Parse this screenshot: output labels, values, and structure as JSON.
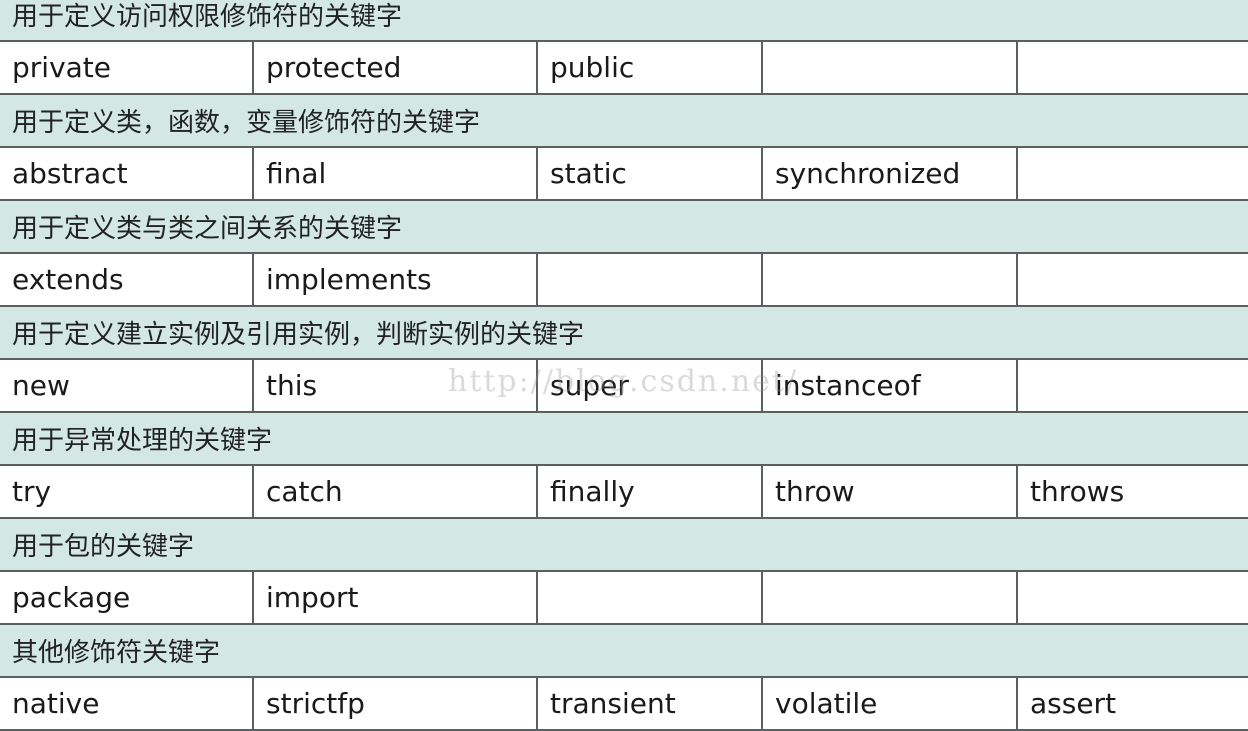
{
  "sections": [
    {
      "title": "用于定义访问权限修饰符的关键字",
      "keywords": [
        "private",
        "protected",
        "public",
        "",
        ""
      ]
    },
    {
      "title": "用于定义类，函数，变量修饰符的关键字",
      "keywords": [
        "abstract",
        "final",
        "static",
        "synchronized",
        ""
      ]
    },
    {
      "title": "用于定义类与类之间关系的关键字",
      "keywords": [
        "extends",
        "implements",
        "",
        "",
        ""
      ]
    },
    {
      "title": "用于定义建立实例及引用实例，判断实例的关键字",
      "keywords": [
        "new",
        "this",
        "super",
        "instanceof",
        ""
      ]
    },
    {
      "title": "用于异常处理的关键字",
      "keywords": [
        "try",
        "catch",
        "finally",
        "throw",
        "throws"
      ]
    },
    {
      "title": "用于包的关键字",
      "keywords": [
        "package",
        "import",
        "",
        "",
        ""
      ]
    },
    {
      "title": "其他修饰符关键字",
      "keywords": [
        "native",
        "strictfp",
        "transient",
        "volatile",
        "assert"
      ]
    }
  ],
  "watermark": "http://blog.csdn.net/",
  "colors": {
    "header_bg": "#d3e8e5",
    "border": "#5a5f5f"
  }
}
